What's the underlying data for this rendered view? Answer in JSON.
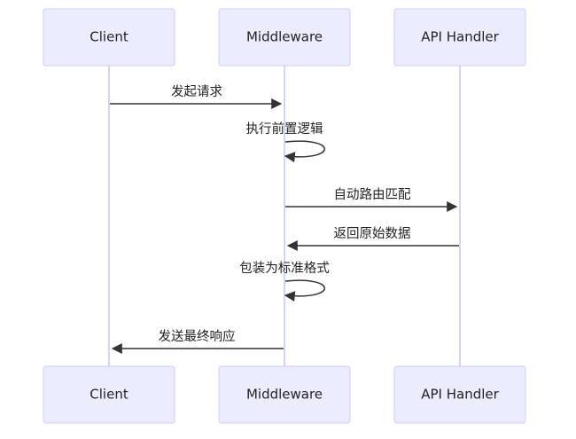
{
  "participants": [
    {
      "id": "client",
      "label": "Client"
    },
    {
      "id": "middleware",
      "label": "Middleware"
    },
    {
      "id": "api",
      "label": "API Handler"
    }
  ],
  "messages": [
    {
      "from": "client",
      "to": "middleware",
      "label": "发起请求"
    },
    {
      "from": "middleware",
      "to": "middleware",
      "label": "执行前置逻辑"
    },
    {
      "from": "middleware",
      "to": "api",
      "label": "自动路由匹配"
    },
    {
      "from": "api",
      "to": "middleware",
      "label": "返回原始数据"
    },
    {
      "from": "middleware",
      "to": "middleware",
      "label": "包装为标准格式"
    },
    {
      "from": "middleware",
      "to": "client",
      "label": "发送最终响应"
    }
  ],
  "colors": {
    "actor_fill": "#ECECFF",
    "actor_stroke": "#CCCCFF",
    "lifeline": "#D4D4F7",
    "arrow": "#333333",
    "text": "#222222"
  }
}
